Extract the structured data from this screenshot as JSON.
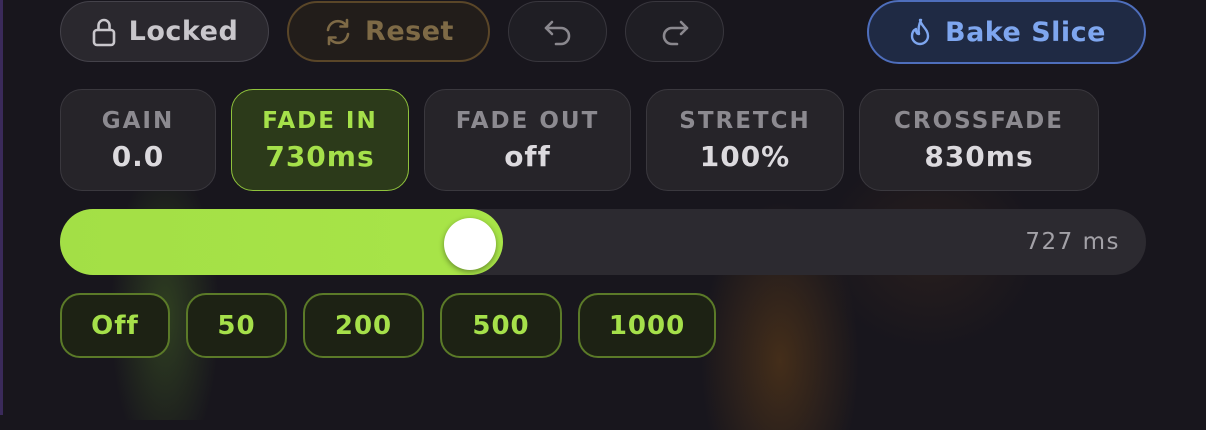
{
  "toolbar": {
    "locked_label": "Locked",
    "reset_label": "Reset",
    "bake_label": "Bake Slice",
    "icons": {
      "lock": "lock-icon",
      "reset": "refresh-icon",
      "undo": "undo-icon",
      "redo": "redo-icon",
      "bake": "flame-icon"
    }
  },
  "params": [
    {
      "label": "GAIN",
      "value": "0.0",
      "active": false
    },
    {
      "label": "FADE IN",
      "value": "730ms",
      "active": true
    },
    {
      "label": "FADE OUT",
      "value": "off",
      "active": false
    },
    {
      "label": "STRETCH",
      "value": "100%",
      "active": false
    },
    {
      "label": "CROSSFADE",
      "value": "830ms",
      "active": false
    }
  ],
  "slider": {
    "readout": "727 ms",
    "fraction": 0.37
  },
  "presets": [
    "Off",
    "50",
    "200",
    "500",
    "1000"
  ],
  "colors": {
    "accent_green": "#a5e04a",
    "reset_amber": "#7e6a46",
    "bake_blue": "#7ea6ef",
    "background": "#18161d"
  }
}
